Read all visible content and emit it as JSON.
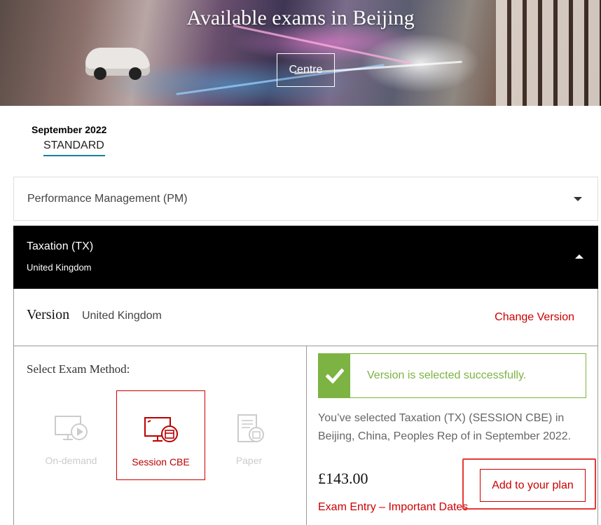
{
  "hero": {
    "title": "Available exams in Beijing",
    "centre_button": "Centre"
  },
  "session": {
    "month": "September 2022",
    "type": "STANDARD"
  },
  "exams": [
    {
      "title": "Performance Management (PM)",
      "expanded": false
    },
    {
      "title": "Taxation (TX)",
      "subtitle": "United Kingdom",
      "expanded": true
    }
  ],
  "version": {
    "label": "Version",
    "value": "United Kingdom",
    "change_link": "Change Version"
  },
  "methods": {
    "title": "Select Exam Method:",
    "options": [
      {
        "label": "On-demand",
        "state": "disabled",
        "icon": "computer-play-icon"
      },
      {
        "label": "Session CBE",
        "state": "selected",
        "icon": "computer-calendar-icon"
      },
      {
        "label": "Paper",
        "state": "disabled",
        "icon": "paper-calendar-icon"
      }
    ]
  },
  "result": {
    "success_message": "Version is selected successfully.",
    "description": "You’ve selected Taxation (TX) (SESSION CBE) in Beijing, China, Peoples Rep of in September 2022.",
    "price": "£143.00",
    "exam_entry_link": "Exam Entry – Important Dates",
    "add_button": "Add to your plan"
  },
  "colors": {
    "accent_red": "#cc0000",
    "success_green": "#7cb342",
    "tab_underline": "#1a7f98",
    "highlight_red": "#e53935"
  }
}
